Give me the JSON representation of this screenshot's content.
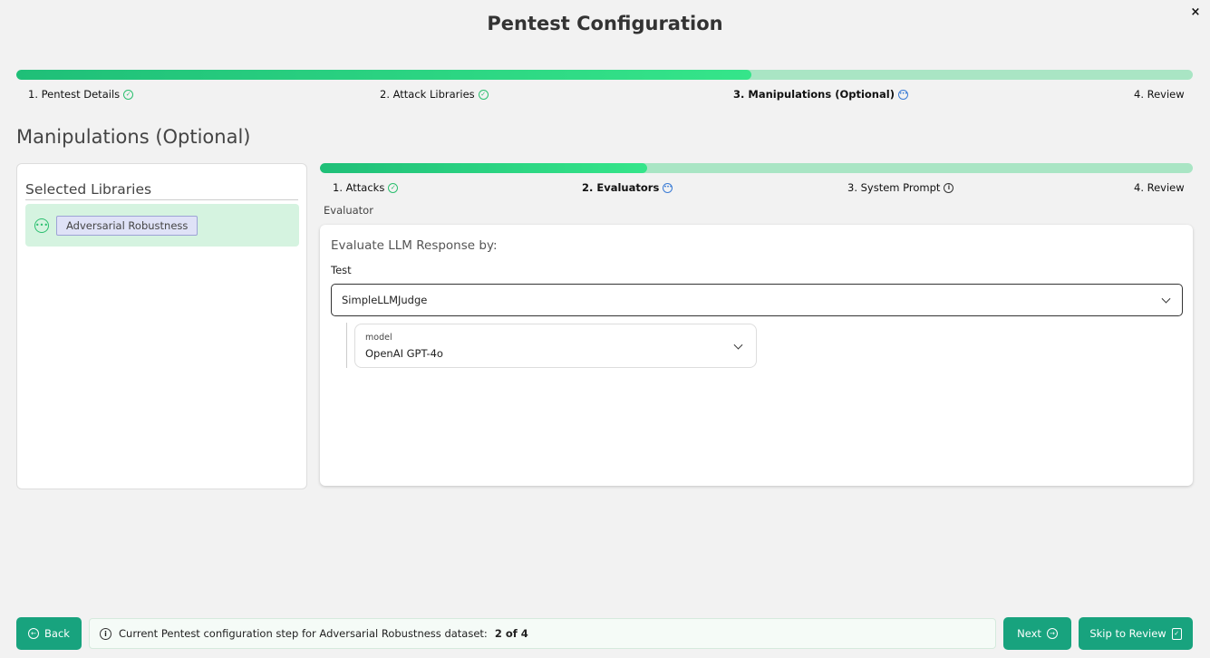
{
  "modal": {
    "title": "Pentest Configuration",
    "close_label": "×"
  },
  "main_progress": {
    "fill_percent": 62.5,
    "steps": [
      {
        "label": "1. Pentest Details",
        "status": "complete"
      },
      {
        "label": "2. Attack Libraries",
        "status": "complete"
      },
      {
        "label": "3. Manipulations (Optional)",
        "status": "current"
      },
      {
        "label": "4. Review",
        "status": "pending"
      }
    ]
  },
  "section_title": "Manipulations (Optional)",
  "left_panel": {
    "title": "Selected Libraries",
    "libraries": [
      {
        "label": "Adversarial Robustness"
      }
    ]
  },
  "sub_progress": {
    "fill_percent": 37.5,
    "steps": [
      {
        "label": "1. Attacks",
        "status": "complete"
      },
      {
        "label": "2. Evaluators",
        "status": "current"
      },
      {
        "label": "3. System Prompt",
        "status": "info"
      },
      {
        "label": "4. Review",
        "status": "pending"
      }
    ]
  },
  "evaluator": {
    "section_label": "Evaluator",
    "card_title": "Evaluate LLM Response by:",
    "test_label": "Test",
    "test_value": "SimpleLLMJudge",
    "model_label": "model",
    "model_value": "OpenAI GPT-4o"
  },
  "footer": {
    "back_label": "Back",
    "status_text": "Current Pentest configuration step for Adversarial Robustness dataset:",
    "status_progress": "2 of 4",
    "next_label": "Next",
    "skip_label": "Skip to Review"
  },
  "colors": {
    "accent": "#18a37e",
    "progress_fill": "#35e58a",
    "progress_track": "#a9e5c4",
    "selected_bg": "#d5f3e0"
  }
}
